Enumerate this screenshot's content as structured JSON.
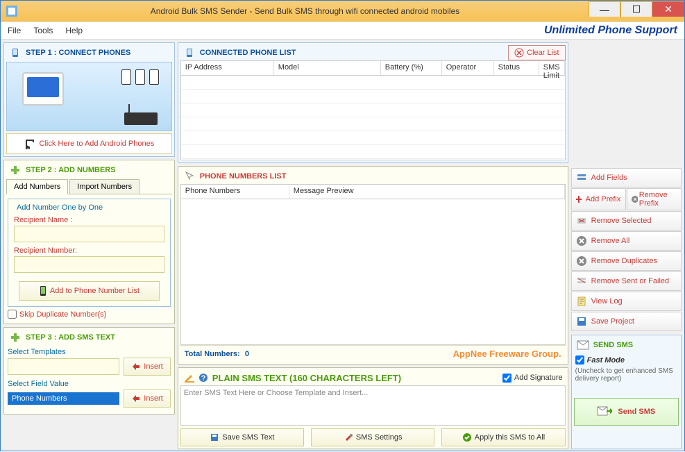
{
  "window": {
    "title": "Android Bulk SMS Sender - Send Bulk SMS through wifi connected android mobiles"
  },
  "menu": {
    "file": "File",
    "tools": "Tools",
    "help": "Help",
    "support": "Unlimited Phone Support"
  },
  "step1": {
    "title": "STEP 1 : CONNECT PHONES",
    "add_btn": "Click Here to Add Android Phones"
  },
  "step2": {
    "title": "STEP 2 : ADD NUMBERS",
    "tab_add": "Add Numbers",
    "tab_import": "Import Numbers",
    "fieldset_title": "Add Number One by One",
    "name_label": "Recipient Name :",
    "number_label": "Recipient Number:",
    "add_btn": "Add to Phone Number List",
    "skip_dup": "Skip Duplicate Number(s)"
  },
  "step3": {
    "title": "STEP 3 : ADD SMS TEXT",
    "select_templates": "Select Templates",
    "insert": "Insert",
    "select_field": "Select Field Value",
    "field_value": "Phone Numbers"
  },
  "connected": {
    "title": "CONNECTED PHONE LIST",
    "clear": "Clear List",
    "cols": [
      "IP Address",
      "Model",
      "Battery (%)",
      "Operator",
      "Status",
      "SMS Limit"
    ]
  },
  "numbers": {
    "title": "PHONE NUMBERS LIST",
    "cols": [
      "Phone Numbers",
      "Message Preview"
    ],
    "total_label": "Total Numbers:",
    "total_value": "0",
    "watermark": "AppNee Freeware Group."
  },
  "sms": {
    "title": "PLAIN SMS TEXT (160 CHARACTERS LEFT)",
    "add_sig": "Add Signature",
    "placeholder": "Enter SMS Text Here or Choose Template and Insert...",
    "save": "Save SMS Text",
    "settings": "SMS Settings",
    "apply": "Apply this SMS to All"
  },
  "rpanel": {
    "add_fields": "Add Fields",
    "add_prefix": "Add Prefix",
    "remove_prefix": "Remove Prefix",
    "remove_selected": "Remove Selected",
    "remove_all": "Remove All",
    "remove_dup": "Remove Duplicates",
    "remove_sent": "Remove Sent or Failed",
    "view_log": "View Log",
    "save_project": "Save Project"
  },
  "send": {
    "title": "SEND SMS",
    "fast_mode": "Fast Mode",
    "note": "(Uncheck to get enhanced SMS delivery report)",
    "send_btn": "Send SMS"
  }
}
